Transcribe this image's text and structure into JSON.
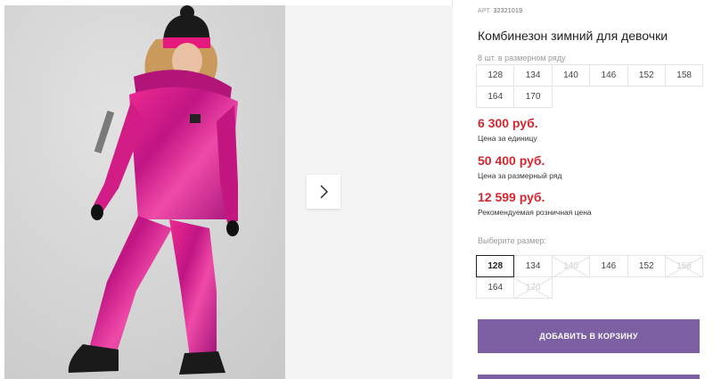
{
  "gallery": {
    "photo_subject": "girl-pink-winter-jumpsuit",
    "next_icon": "chevron-right-icon"
  },
  "product": {
    "article_label": "АРТ.",
    "article_number": "32321019",
    "title": "Комбинезон зимний для девочки",
    "row_caption": "8 шт. в размерном ряду",
    "row_sizes": [
      "128",
      "134",
      "140",
      "146",
      "152",
      "158",
      "164",
      "170"
    ],
    "prices": [
      {
        "value": "6 300 руб.",
        "note": "Цена за единицу"
      },
      {
        "value": "50 400 руб.",
        "note": "Цена за размерный ряд"
      },
      {
        "value": "12 599 руб.",
        "note": "Рекомендуемая розничная цена"
      }
    ],
    "select_caption": "Выберите размер:",
    "select_sizes": [
      {
        "label": "128",
        "state": "selected"
      },
      {
        "label": "134",
        "state": "available"
      },
      {
        "label": "140",
        "state": "unavailable"
      },
      {
        "label": "146",
        "state": "available"
      },
      {
        "label": "152",
        "state": "available"
      },
      {
        "label": "158",
        "state": "unavailable"
      },
      {
        "label": "164",
        "state": "available"
      },
      {
        "label": "170",
        "state": "unavailable"
      }
    ],
    "add_to_cart_label": "ДОБАВИТЬ В КОРЗИНУ"
  },
  "colors": {
    "price_red": "#d6262f",
    "button_purple": "#7d5fa3",
    "jumpsuit_pink": "#e6197e"
  }
}
